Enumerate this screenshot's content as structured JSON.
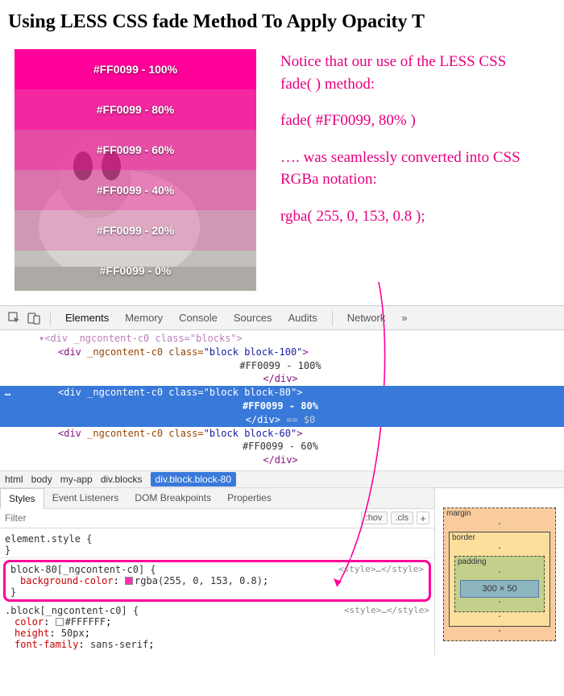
{
  "title": "Using LESS CSS fade Method To Apply Opacity T",
  "stripes": [
    {
      "label": "#FF0099 - 100%",
      "cls": "s100"
    },
    {
      "label": "#FF0099 - 80%",
      "cls": "s80"
    },
    {
      "label": "#FF0099 - 60%",
      "cls": "s60"
    },
    {
      "label": "#FF0099 - 40%",
      "cls": "s40"
    },
    {
      "label": "#FF0099 - 20%",
      "cls": "s20"
    },
    {
      "label": "#FF0099 - 0%",
      "cls": "s0"
    }
  ],
  "annotation": {
    "p1": "Notice that our use of the LESS CSS fade( ) method:",
    "p2": "fade( #FF0099, 80% )",
    "p3": "…. was seamlessly converted into CSS RGBa notation:",
    "p4": "rgba( 255, 0, 153, 0.8 );"
  },
  "devtools": {
    "tabs": [
      "Elements",
      "Memory",
      "Console",
      "Sources",
      "Audits",
      "Network"
    ],
    "active_tab": "Elements",
    "more": "»",
    "dom": {
      "l0": "▾<div _ngcontent-c0 class=\"blocks\">",
      "l1a": "<div ",
      "l1b": "_ngcontent-c0",
      "l1c": " class=",
      "l1d": "\"block block-100\"",
      "l1e": ">",
      "l2": "#FF0099 - 100%",
      "l3": "</div>",
      "l4a": "<div ",
      "l4b": "_ngcontent-c0",
      "l4c": " class=",
      "l4d": "\"block block-80\"",
      "l4e": ">",
      "l5": "#FF0099 - 80%",
      "l6": "</div>",
      "l6eq": " == $0",
      "l7a": "<div ",
      "l7b": "_ngcontent-c0",
      "l7c": " class=",
      "l7d": "\"block block-60\"",
      "l7e": ">",
      "l8": "#FF0099 - 60%",
      "l9": "</div>"
    },
    "crumbs": [
      "html",
      "body",
      "my-app",
      "div.blocks",
      "div.block.block-80"
    ],
    "sel_crumb": 4,
    "subtabs": [
      "Styles",
      "Event Listeners",
      "DOM Breakpoints",
      "Properties"
    ],
    "active_subtab": "Styles",
    "filter_placeholder": "Filter",
    "hov": ":hov",
    "cls": ".cls",
    "rules": {
      "r0": {
        "sel": "element.style {",
        "close": "}"
      },
      "r1": {
        "sel": "block-80[_ngcontent-c0] {",
        "prop": "background-color",
        "val": "rgba(255, 0, 153, 0.8)",
        "swatch": "#ff0099",
        "close": "}",
        "origin": "<style>…</style>"
      },
      "r2": {
        "sel": ".block[_ngcontent-c0] {",
        "origin": "<style>…</style>",
        "props": [
          {
            "p": "color",
            "v": "#FFFFFF",
            "sw": "#ffffff"
          },
          {
            "p": "height",
            "v": "50px"
          },
          {
            "p": "font-family",
            "v": "sans-serif"
          }
        ]
      }
    },
    "boxmodel": {
      "margin": "margin",
      "border": "border",
      "padding": "padding",
      "content": "300 × 50",
      "dash": "-"
    }
  }
}
